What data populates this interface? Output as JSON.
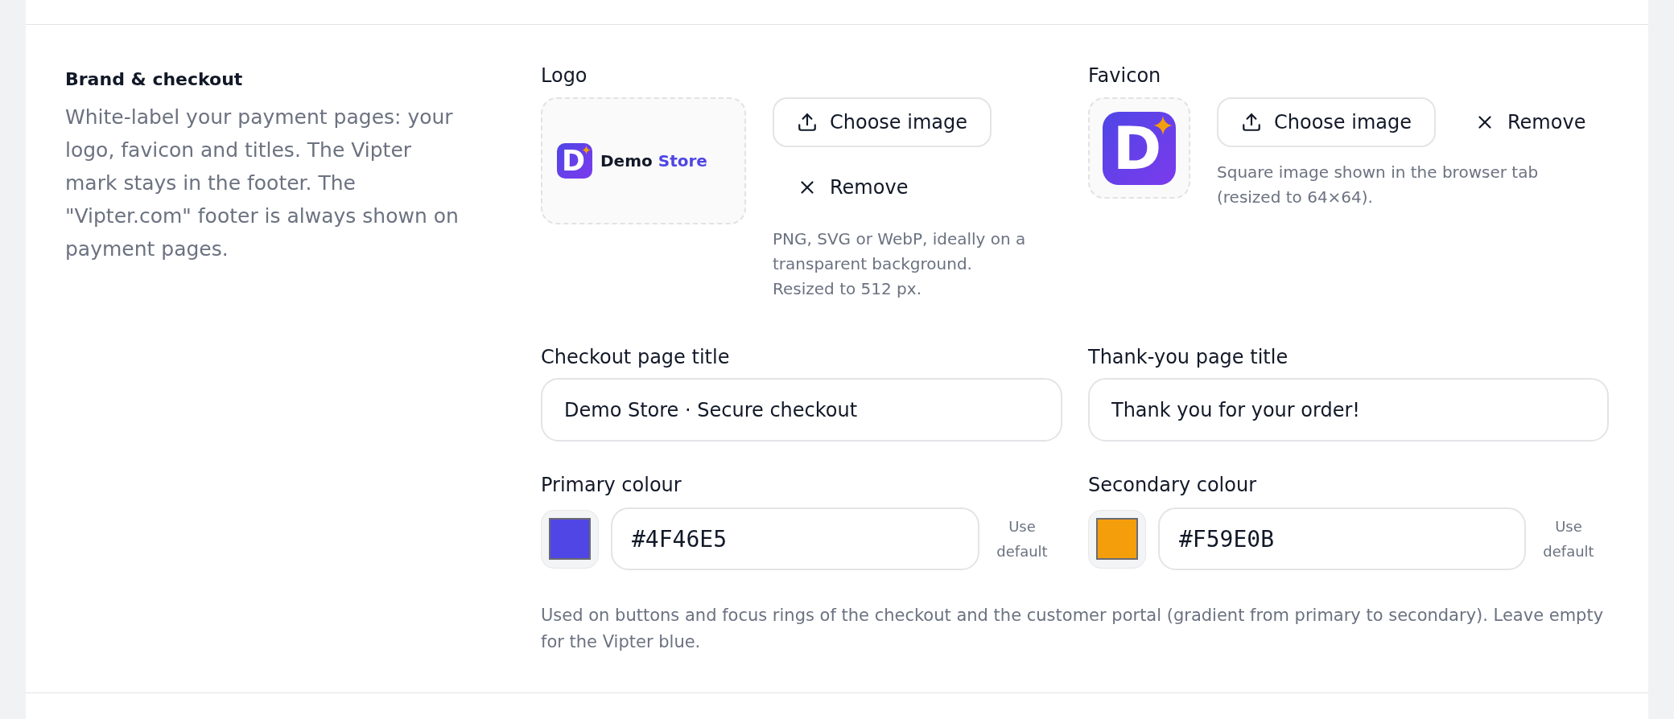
{
  "section": {
    "title": "Brand & checkout",
    "description": "White-label your payment pages: your logo, favicon and titles. The Vipter mark stays in the footer. The \"Vipter.com\" footer is always shown on payment pages."
  },
  "uploads": [
    {
      "kind": "logo",
      "label": "Logo",
      "preview": {
        "mark_letter": "D",
        "wordmark": [
          {
            "text": "Demo",
            "accent": false
          },
          {
            "text": "Store",
            "accent": true
          }
        ]
      },
      "choose_button": "Choose image",
      "remove_button": "Remove",
      "hint": "PNG, SVG or WebP, ideally on a transparent background. Resized to 512 px."
    },
    {
      "kind": "favicon",
      "label": "Favicon",
      "preview": {
        "mark_letter": "D"
      },
      "choose_button": "Choose image",
      "remove_button": "Remove",
      "hint": "Square image shown in the browser tab (resized to 64×64)."
    }
  ],
  "title_fields": [
    {
      "label": "Checkout page title",
      "value": "Demo Store · Secure checkout"
    },
    {
      "label": "Thank-you page title",
      "value": "Thank you for your order!"
    }
  ],
  "colour_fields": [
    {
      "label": "Primary colour",
      "color": "#4f46e5",
      "value": "#4F46E5",
      "reset_button": "Use default"
    },
    {
      "label": "Secondary colour",
      "color": "#f59e0b",
      "value": "#F59E0B",
      "reset_button": "Use default"
    }
  ],
  "colour_hint": "Used on buttons and focus rings of the checkout and the customer portal (gradient from primary to secondary). Leave empty for the Vipter blue."
}
